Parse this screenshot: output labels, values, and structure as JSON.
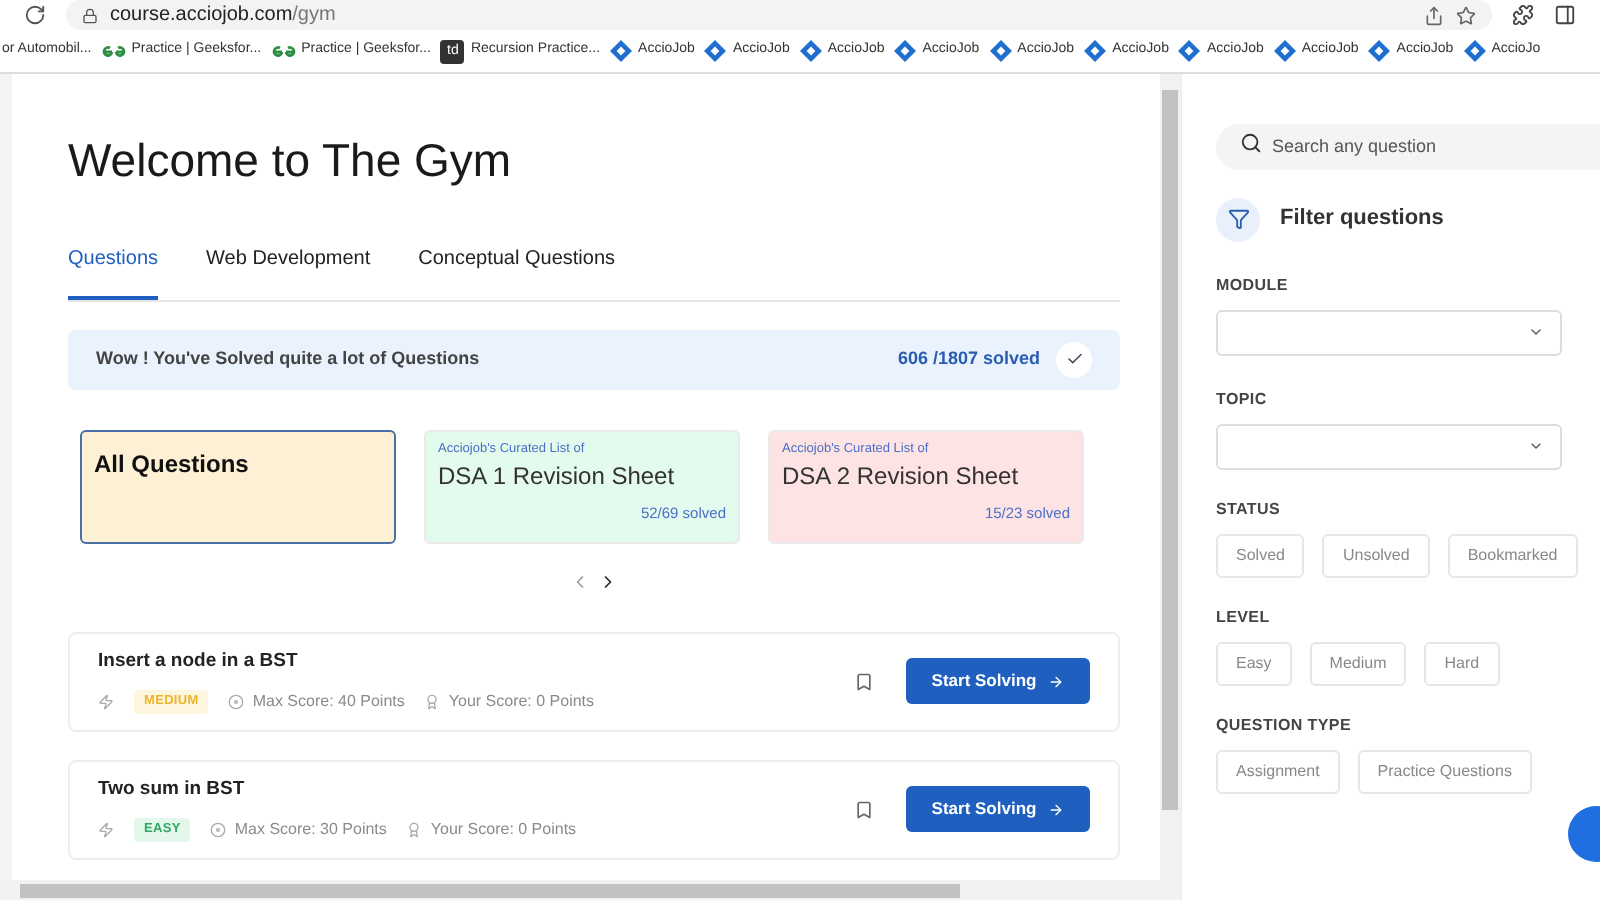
{
  "browser": {
    "url_host": "course.acciojob.com",
    "url_path": "/gym",
    "bookmarks": [
      {
        "kind": "plain",
        "label": "or Automobil..."
      },
      {
        "kind": "geeks",
        "label": "Practice | Geeksfor..."
      },
      {
        "kind": "geeks",
        "label": "Practice | Geeksfor..."
      },
      {
        "kind": "td",
        "label": "Recursion Practice...",
        "icon_text": "td"
      },
      {
        "kind": "accio",
        "label": "AccioJob"
      },
      {
        "kind": "accio",
        "label": "AccioJob"
      },
      {
        "kind": "accio",
        "label": "AccioJob"
      },
      {
        "kind": "accio",
        "label": "AccioJob"
      },
      {
        "kind": "accio",
        "label": "AccioJob"
      },
      {
        "kind": "accio",
        "label": "AccioJob"
      },
      {
        "kind": "accio",
        "label": "AccioJob"
      },
      {
        "kind": "accio",
        "label": "AccioJob"
      },
      {
        "kind": "accio",
        "label": "AccioJob"
      },
      {
        "kind": "accio",
        "label": "AccioJo"
      }
    ]
  },
  "page": {
    "title": "Welcome to The Gym",
    "tabs": [
      {
        "label": "Questions",
        "selected": true
      },
      {
        "label": "Web Development",
        "selected": false
      },
      {
        "label": "Conceptual Questions",
        "selected": false
      }
    ],
    "banner": {
      "message": "Wow ! You've Solved quite a lot of Questions",
      "count": "606 /1807 solved"
    },
    "sheets": [
      {
        "title": "All Questions",
        "selected": true,
        "color": "#fdf0d5"
      },
      {
        "caption": "Acciojob's Curated List of",
        "title": "DSA 1 Revision Sheet",
        "progress": "52/69 solved",
        "selected": false,
        "color": "#e3fbec"
      },
      {
        "caption": "Acciojob's Curated List of",
        "title": "DSA 2 Revision Sheet",
        "progress": "15/23 solved",
        "selected": false,
        "color": "#fde3e3"
      }
    ],
    "questions": [
      {
        "title": "Insert a node in a BST",
        "difficulty": "MEDIUM",
        "kind": "medium",
        "max_score": "Max Score: 40 Points",
        "your_score": "Your Score: 0 Points",
        "action": "Start Solving"
      },
      {
        "title": "Two sum in BST",
        "difficulty": "EASY",
        "kind": "easy",
        "max_score": "Max Score: 30 Points",
        "your_score": "Your Score: 0 Points",
        "action": "Start Solving"
      }
    ]
  },
  "sidebar": {
    "search": {
      "placeholder": "Search any question"
    },
    "filter_title": "Filter questions",
    "module_label": "MODULE",
    "topic_label": "TOPIC",
    "groups": [
      {
        "label": "STATUS",
        "options": [
          "Solved",
          "Unsolved",
          "Bookmarked"
        ]
      },
      {
        "label": "LEVEL",
        "options": [
          "Easy",
          "Medium",
          "Hard"
        ]
      },
      {
        "label": "QUESTION TYPE",
        "options": [
          "Assignment",
          "Practice Questions"
        ]
      }
    ]
  }
}
